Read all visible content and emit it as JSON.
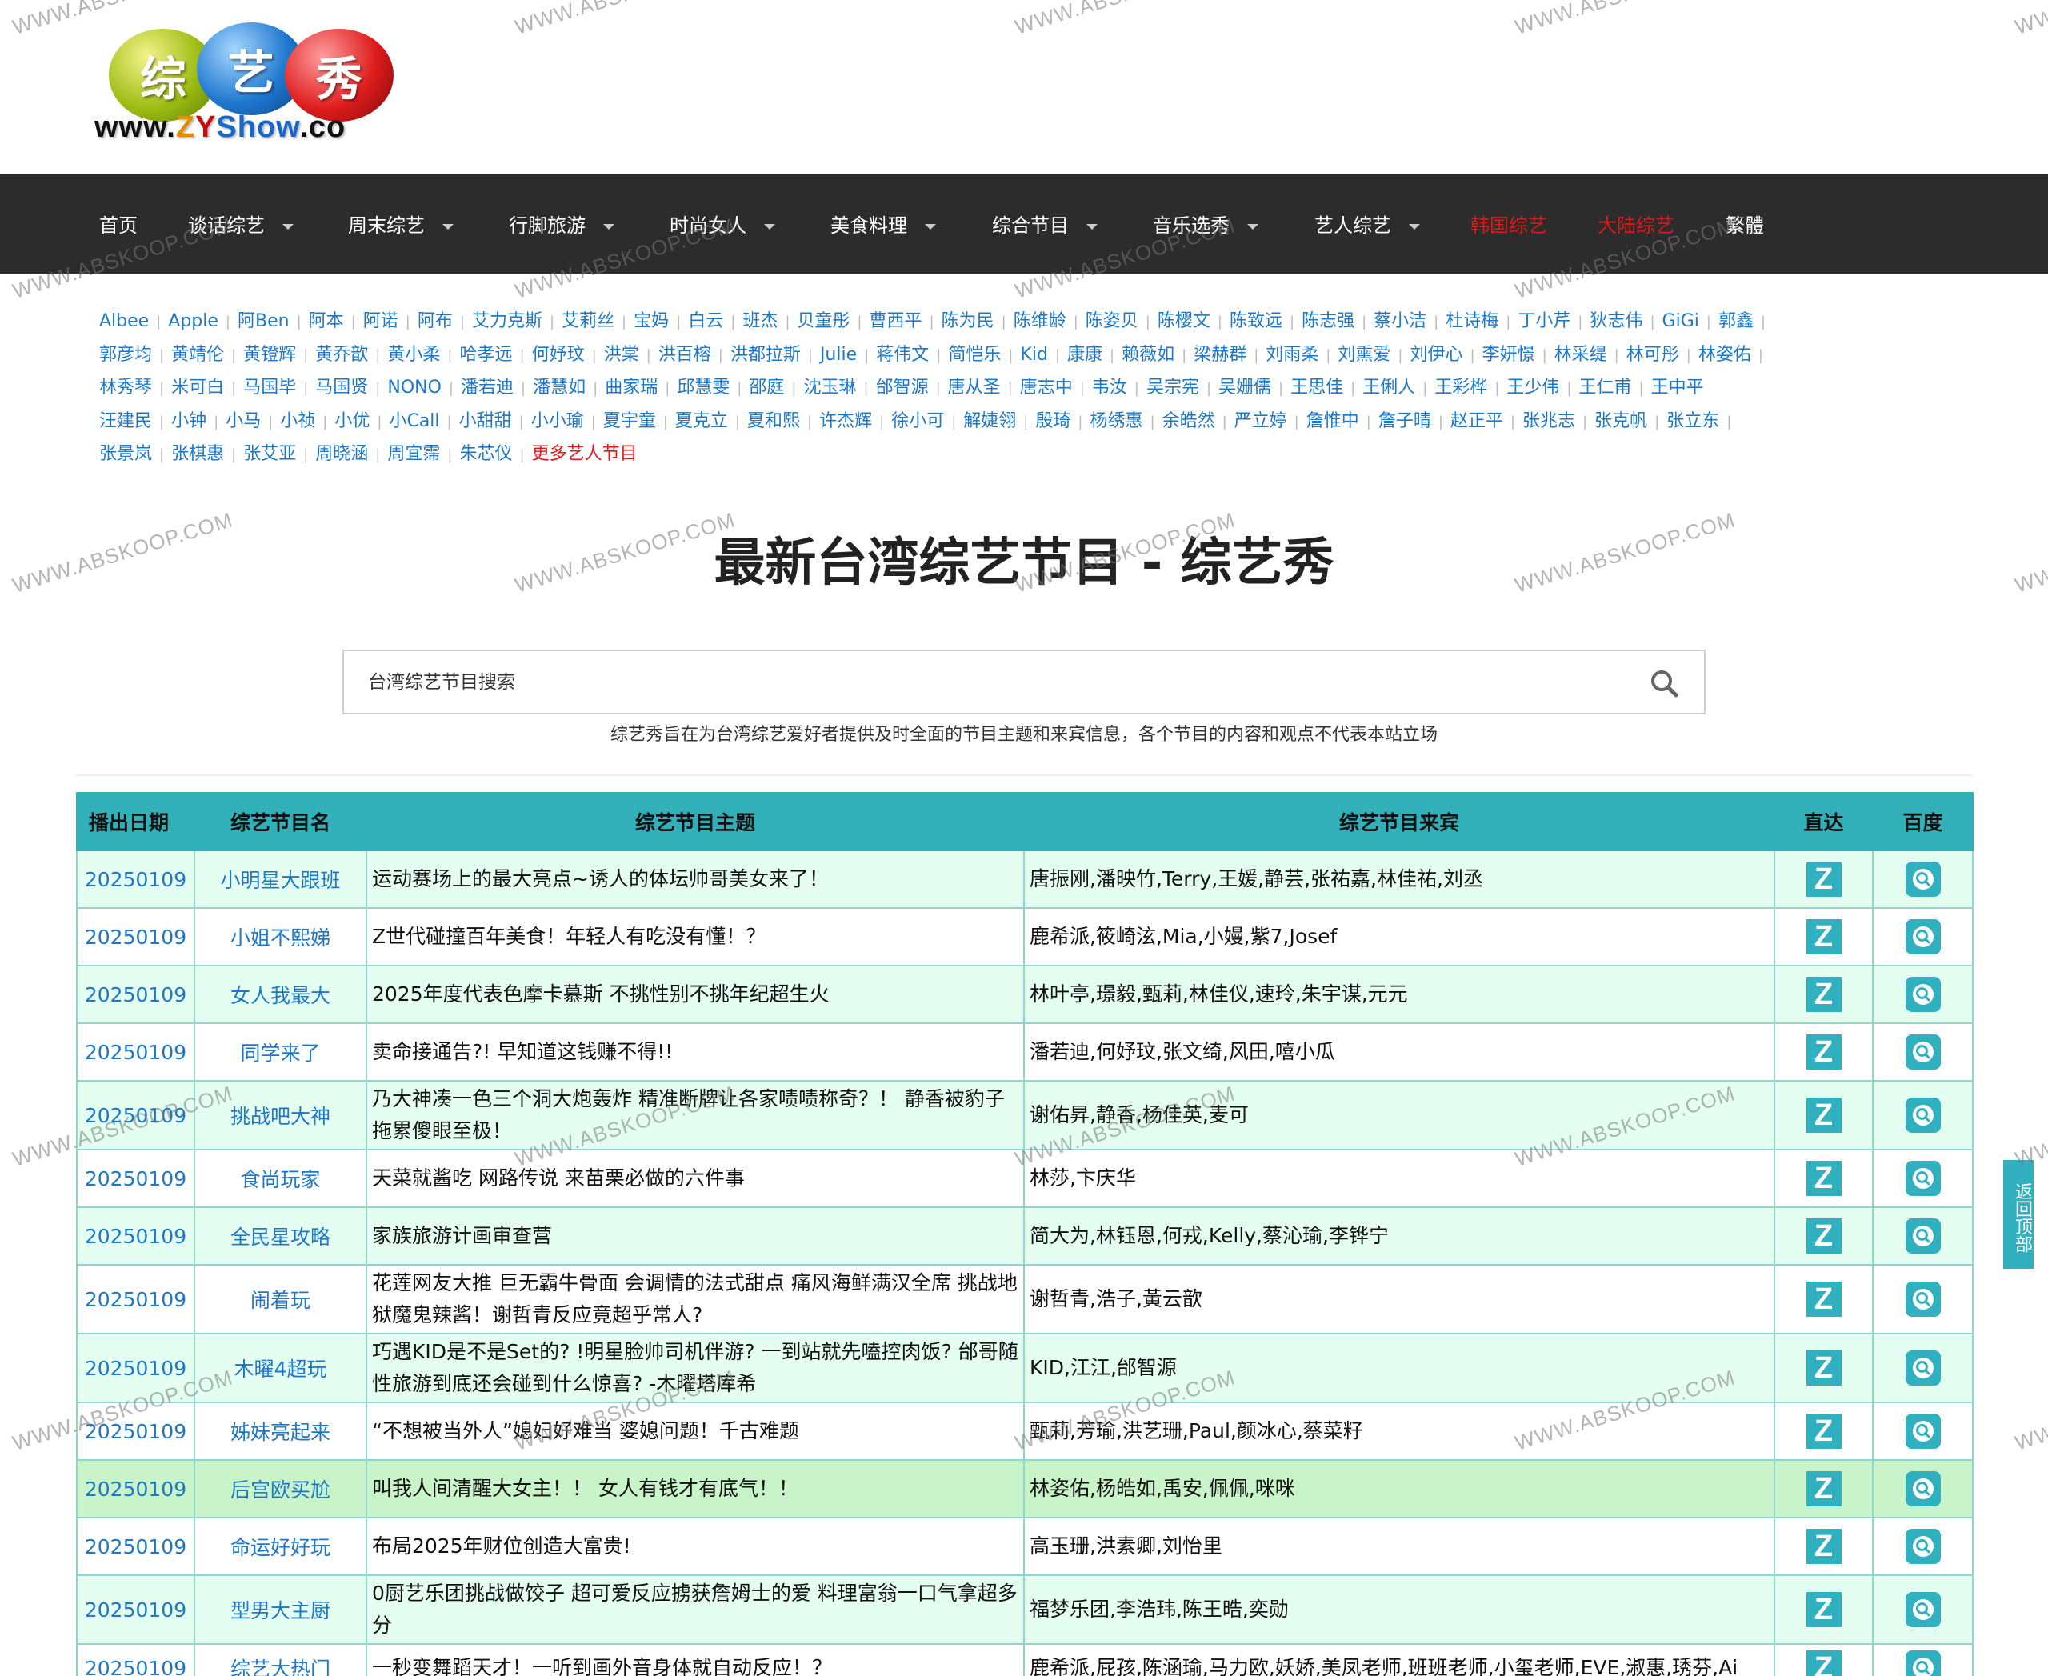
{
  "logo": {
    "chars": [
      "综",
      "艺",
      "秀"
    ],
    "url_prefix": "www.",
    "url_z": "Z",
    "url_y": "Y",
    "url_s": "Show",
    "url_suffix": ".co"
  },
  "nav": [
    {
      "label": "首页",
      "dropdown": false,
      "red": false
    },
    {
      "label": "谈话综艺",
      "dropdown": true,
      "red": false
    },
    {
      "label": "周末综艺",
      "dropdown": true,
      "red": false
    },
    {
      "label": "行脚旅游",
      "dropdown": true,
      "red": false
    },
    {
      "label": "时尚女人",
      "dropdown": true,
      "red": false
    },
    {
      "label": "美食料理",
      "dropdown": true,
      "red": false
    },
    {
      "label": "综合节目",
      "dropdown": true,
      "red": false
    },
    {
      "label": "音乐选秀",
      "dropdown": true,
      "red": false
    },
    {
      "label": "艺人综艺",
      "dropdown": true,
      "red": false
    },
    {
      "label": "韩国综艺",
      "dropdown": false,
      "red": true
    },
    {
      "label": "大陆综艺",
      "dropdown": false,
      "red": true
    },
    {
      "label": "繁體",
      "dropdown": false,
      "red": false
    }
  ],
  "artists": [
    [
      "Albee",
      "Apple",
      "阿Ben",
      "阿本",
      "阿诺",
      "阿布",
      "艾力克斯",
      "艾莉丝",
      "宝妈",
      "白云",
      "班杰",
      "贝童彤",
      "曹西平",
      "陈为民",
      "陈维龄",
      "陈姿贝",
      "陈樱文",
      "陈致远",
      "陈志强",
      "蔡小洁",
      "杜诗梅",
      "丁小芹",
      "狄志伟",
      "GiGi",
      "郭鑫"
    ],
    [
      "郭彦均",
      "黄靖伦",
      "黄镫辉",
      "黄乔歆",
      "黄小柔",
      "哈孝远",
      "何妤玟",
      "洪棠",
      "洪百榕",
      "洪都拉斯",
      "Julie",
      "蒋伟文",
      "简恺乐",
      "Kid",
      "康康",
      "赖薇如",
      "梁赫群",
      "刘雨柔",
      "刘熏爱",
      "刘伊心",
      "李妍憬",
      "林采缇",
      "林可彤",
      "林姿佑"
    ],
    [
      "林秀琴",
      "米可白",
      "马国毕",
      "马国贤",
      "NONO",
      "潘若迪",
      "潘慧如",
      "曲家瑞",
      "邱慧雯",
      "邵庭",
      "沈玉琳",
      "邰智源",
      "唐从圣",
      "唐志中",
      "韦汝",
      "吴宗宪",
      "吴姗儒",
      "王思佳",
      "王俐人",
      "王彩桦",
      "王少伟",
      "王仁甫",
      "王中平"
    ],
    [
      "汪建民",
      "小钟",
      "小马",
      "小祯",
      "小优",
      "小Call",
      "小甜甜",
      "小小瑜",
      "夏宇童",
      "夏克立",
      "夏和熙",
      "许杰辉",
      "徐小可",
      "解婕翎",
      "殷琦",
      "杨绣惠",
      "余皓然",
      "严立婷",
      "詹惟中",
      "詹子晴",
      "赵正平",
      "张兆志",
      "张克帆",
      "张立东"
    ],
    [
      "张景岚",
      "张棋惠",
      "张艾亚",
      "周晓涵",
      "周宜霈",
      "朱芯仪"
    ]
  ],
  "more_artists": "更多艺人节目",
  "page_title": "最新台湾综艺节目 - 综艺秀",
  "search": {
    "placeholder": "台湾综艺节目搜索"
  },
  "disclaimer": "综艺秀旨在为台湾综艺爱好者提供及时全面的节目主题和来宾信息，各个节目的内容和观点不代表本站立场",
  "table": {
    "headers": [
      "播出日期",
      "综艺节目名",
      "综艺节目主题",
      "综艺节目来宾",
      "直达",
      "百度"
    ],
    "rows": [
      {
        "date": "20250109",
        "show": "小明星大跟班",
        "topic": "运动赛场上的最大亮点~诱人的体坛帅哥美女来了！",
        "guests": "唐振刚,潘映竹,Terry,王媛,静芸,张祐嘉,林佳祐,刘丞"
      },
      {
        "date": "20250109",
        "show": "小姐不熙娣",
        "topic": "Z世代碰撞百年美食！年轻人有吃没有懂！？",
        "guests": "鹿希派,筱崎泫,Mia,小嫚,紫7,Josef"
      },
      {
        "date": "20250109",
        "show": "女人我最大",
        "topic": "2025年度代表色摩卡慕斯 不挑性别不挑年纪超生火",
        "guests": "林叶亭,璟毅,甄莉,林佳仪,速玲,朱宇谋,元元"
      },
      {
        "date": "20250109",
        "show": "同学来了",
        "topic": "卖命接通告?! 早知道这钱赚不得!!",
        "guests": "潘若迪,何妤玟,张文绮,风田,嘻小瓜"
      },
      {
        "date": "20250109",
        "show": "挑战吧大神",
        "topic": "乃大神凑一色三个洞大炮轰炸 精准断牌让各家啧啧称奇？！ 静香被豹子拖累傻眼至极！",
        "guests": "谢佑昇,静香,杨佳英,麦可"
      },
      {
        "date": "20250109",
        "show": "食尚玩家",
        "topic": "天菜就酱吃 网路传说 来苗栗必做的六件事",
        "guests": "林莎,卞庆华"
      },
      {
        "date": "20250109",
        "show": "全民星攻略",
        "topic": "家族旅游计画审查营",
        "guests": "简大为,林钰恩,何戎,Kelly,蔡沁瑜,李铧宁"
      },
      {
        "date": "20250109",
        "show": "闹着玩",
        "topic": "花莲网友大推 巨无霸牛骨面 会调情的法式甜点 痛风海鲜满汉全席 挑战地狱魔鬼辣酱！谢哲青反应竟超乎常人?",
        "guests": "谢哲青,浩子,黃云歆"
      },
      {
        "date": "20250109",
        "show": "木曜4超玩",
        "topic": "巧遇KID是不是Set的? !明星脸帅司机伴游? 一到站就先嗑控肉饭? 邰哥随性旅游到底还会碰到什么惊喜? -木曜塔库希",
        "guests": "KID,江江,邰智源"
      },
      {
        "date": "20250109",
        "show": "姊妹亮起来",
        "topic": "“不想被当外人”媳妇好难当 婆媳问题！千古难题",
        "guests": "甄莉,芳瑜,洪艺珊,Paul,颜冰心,蔡菜籽"
      },
      {
        "date": "20250109",
        "show": "后宫欧买尬",
        "topic": "叫我人间清醒大女主！！ 女人有钱才有底气！！",
        "guests": "林姿佑,杨皓如,禹安,佩佩,咪咪"
      },
      {
        "date": "20250109",
        "show": "命运好好玩",
        "topic": "布局2025年财位创造大富贵!",
        "guests": "高玉珊,洪素卿,刘怡里"
      },
      {
        "date": "20250109",
        "show": "型男大主厨",
        "topic": "0厨艺乐团挑战做饺子 超可爱反应掳获詹姆士的爱 料理富翁一口气拿超多分",
        "guests": "福梦乐团,李浩玮,陈王晧,奕勋"
      },
      {
        "date": "20250109",
        "show": "综艺大热门",
        "topic": "一秒变舞蹈天才！一听到画外音身体就自动反应！？",
        "guests": "鹿希派,屁孩,陈涵瑜,马力欧,妖娇,美凤老师,班班老师,小玺老师,EVE,淑惠,琇芬,Ai"
      }
    ]
  },
  "back_to_top": "返回顶部",
  "watermark": "WWW.ABSKOOP.COM",
  "colors": {
    "accent": "#31b0b9",
    "link": "#1e78c8",
    "red": "#e01717",
    "nav_bg": "#2c2c2c",
    "row_alt": "#e4fff2",
    "row_hl": "#c9f4c9"
  }
}
